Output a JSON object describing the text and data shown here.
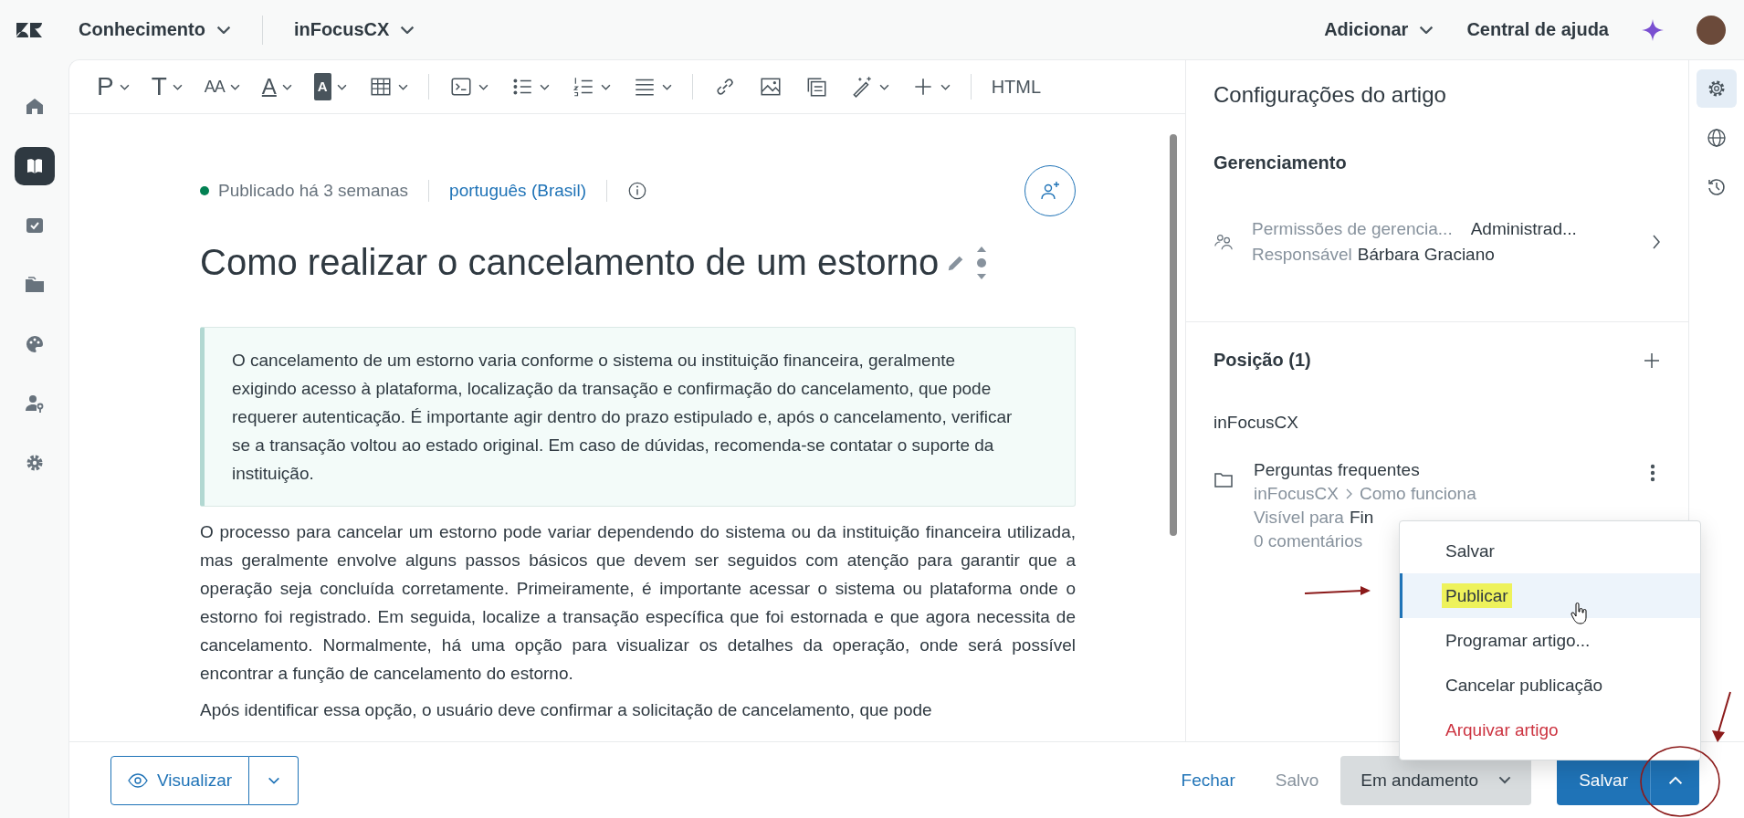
{
  "header": {
    "product": "Conhecimento",
    "brand": "inFocusCX",
    "add": "Adicionar",
    "help_center": "Central de ajuda"
  },
  "sidebar": {
    "items": [
      {
        "kind": "home",
        "selected": false
      },
      {
        "kind": "book",
        "selected": true
      },
      {
        "kind": "check",
        "selected": false
      },
      {
        "kind": "folder",
        "selected": false
      },
      {
        "kind": "palette",
        "selected": false
      },
      {
        "kind": "user-key",
        "selected": false
      },
      {
        "kind": "gear",
        "selected": false
      }
    ]
  },
  "toolbar": {
    "items": [
      {
        "kind": "glyph",
        "glyph": "P",
        "dropdown": true
      },
      {
        "kind": "glyph",
        "glyph": "T",
        "dropdown": true
      },
      {
        "kind": "small-caps",
        "glyph": "AA",
        "dropdown": true
      },
      {
        "kind": "underline",
        "glyph": "A",
        "dropdown": true
      },
      {
        "kind": "boxed",
        "glyph": "A",
        "dropdown": true
      },
      {
        "kind": "table",
        "dropdown": true
      },
      {
        "kind": "divider"
      },
      {
        "kind": "code",
        "dropdown": true
      },
      {
        "kind": "bullets",
        "dropdown": true
      },
      {
        "kind": "numbers",
        "dropdown": true
      },
      {
        "kind": "align",
        "dropdown": true
      },
      {
        "kind": "divider"
      },
      {
        "kind": "link",
        "dropdown": false
      },
      {
        "kind": "image",
        "dropdown": false
      },
      {
        "kind": "copy",
        "dropdown": false
      },
      {
        "kind": "wand",
        "dropdown": true
      },
      {
        "kind": "plus",
        "dropdown": true
      },
      {
        "kind": "divider"
      },
      {
        "kind": "text",
        "glyph": "HTML",
        "dropdown": false
      }
    ]
  },
  "article": {
    "status": "Publicado há 3 semanas",
    "language": "português (Brasil)",
    "title": "Como realizar o cancelamento de um estorno",
    "summary": "O cancelamento de um estorno varia conforme o sistema ou instituição financeira, geralmente exigindo acesso à plataforma, localização da transação e confirmação do cancelamento, que pode requerer autenticação. É importante agir dentro do prazo estipulado e, após o cancelamento, verificar se a transação voltou ao estado original. Em caso de dúvidas, recomenda-se contatar o suporte da instituição.",
    "paragraphs": [
      "O processo para cancelar um estorno pode variar dependendo do sistema ou da instituição financeira utilizada, mas geralmente envolve alguns passos básicos que devem ser seguidos com atenção para garantir que a operação seja concluída corretamente. Primeiramente, é importante acessar o sistema ou plataforma onde o estorno foi registrado. Em seguida, localize a transação específica que foi estornada e que agora necessita de cancelamento. Normalmente, há uma opção para visualizar os detalhes da operação, onde será possível encontrar a função de cancelamento do estorno.",
      "Após identificar essa opção, o usuário deve confirmar a solicitação de cancelamento, que pode"
    ]
  },
  "settings": {
    "title": "Configurações do artigo",
    "management": {
      "heading": "Gerenciamento",
      "permissions_label": "Permissões de gerencia...",
      "permissions_value": "Administrad...",
      "owner_label": "Responsável",
      "owner_value": "Bárbara Graciano"
    },
    "position": {
      "heading": "Posição (1)",
      "brand": "inFocusCX",
      "section_title": "Perguntas frequentes",
      "path": [
        "inFocusCX",
        "Como funciona"
      ],
      "visibility_label": "Visível para",
      "visibility_value": "Fin",
      "comments": "0 comentários"
    }
  },
  "rail": [
    {
      "kind": "settings",
      "selected": true
    },
    {
      "kind": "globe",
      "selected": false
    },
    {
      "kind": "history",
      "selected": false
    }
  ],
  "footer": {
    "preview": "Visualizar",
    "close": "Fechar",
    "saved": "Salvo",
    "status": "Em andamento",
    "save": "Salvar"
  },
  "menu": {
    "items": [
      {
        "label": "Salvar",
        "kind": "normal",
        "selected": false,
        "highlighted": false
      },
      {
        "label": "Publicar",
        "kind": "normal",
        "selected": true,
        "highlighted": true
      },
      {
        "label": "Programar artigo...",
        "kind": "normal",
        "selected": false,
        "highlighted": false
      },
      {
        "label": "Cancelar publicação",
        "kind": "normal",
        "selected": false,
        "highlighted": false
      },
      {
        "label": "Arquivar artigo",
        "kind": "danger",
        "selected": false,
        "highlighted": false
      }
    ]
  }
}
